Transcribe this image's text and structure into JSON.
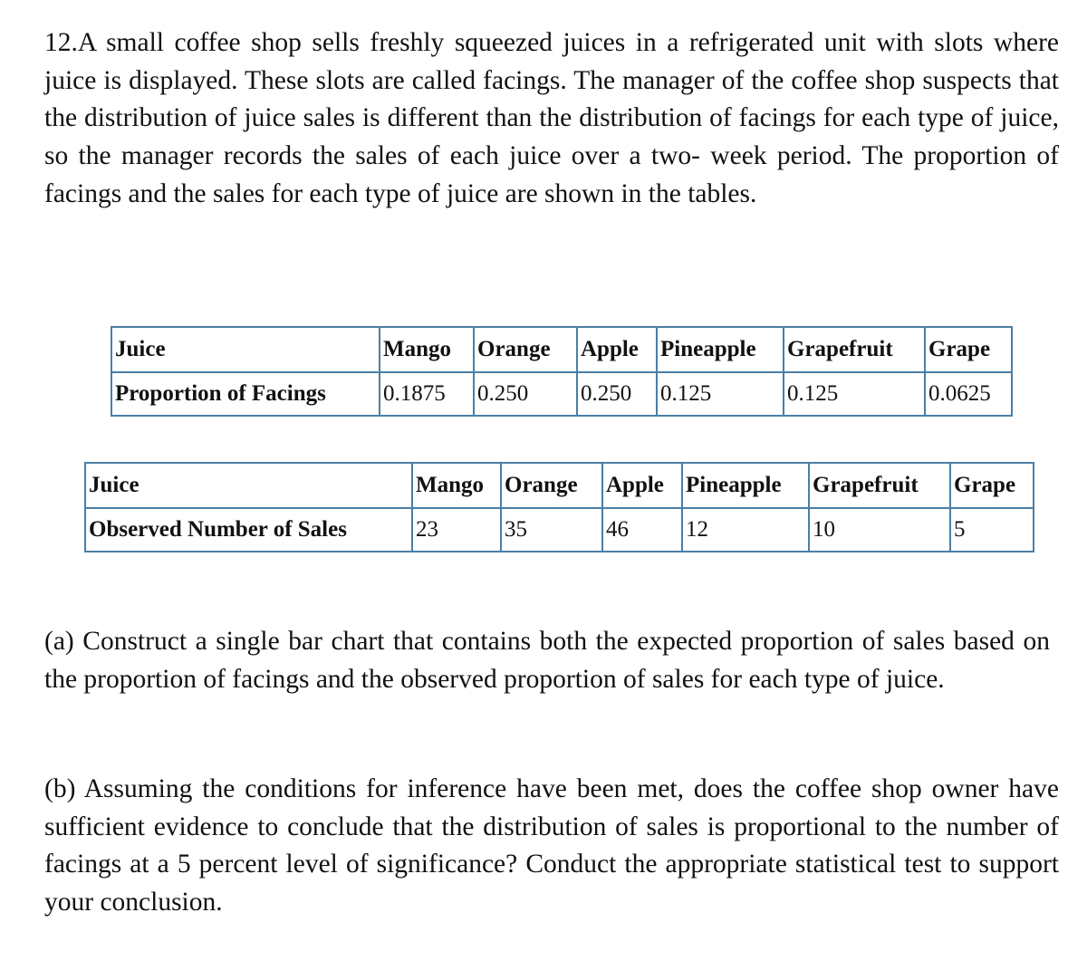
{
  "question": {
    "intro": "12.A small coffee shop sells freshly squeezed juices in a refrigerated unit with slots where juice is displayed. These slots are called facings. The manager of the coffee shop suspects that the distribution of juice sales is different than the distribution of facings for each type of juice, so the manager records the sales of each juice over a two- week period. The proportion of facings and the sales for each type of juice are shown in the tables.",
    "part_a": "(a) Construct a single bar chart that contains both the expected proportion of sales based on the proportion of facings and the observed proportion of sales for each type of juice.",
    "part_b": "(b) Assuming the conditions for inference have been met, does the coffee shop owner have sufficient evidence to conclude that the distribution of sales is proportional to the number of facings at a 5 percent level of significance? Conduct the appropriate statistical test to support your conclusion."
  },
  "facings_table": {
    "header_label": "Juice",
    "row_label": "Proportion of Facings",
    "juices": [
      "Mango",
      "Orange",
      "Apple",
      "Pineapple",
      "Grapefruit",
      "Grape"
    ],
    "values": [
      "0.1875",
      "0.250",
      "0.250",
      "0.125",
      "0.125",
      "0.0625"
    ]
  },
  "sales_table": {
    "header_label": "Juice",
    "row_label": "Observed Number of Sales",
    "juices": [
      "Mango",
      "Orange",
      "Apple",
      "Pineapple",
      "Grapefruit",
      "Grape"
    ],
    "values": [
      "23",
      "35",
      "46",
      "12",
      "10",
      "5"
    ]
  },
  "colors": {
    "table_border": "#4a7fa6",
    "text": "#111111",
    "background": "#ffffff"
  }
}
